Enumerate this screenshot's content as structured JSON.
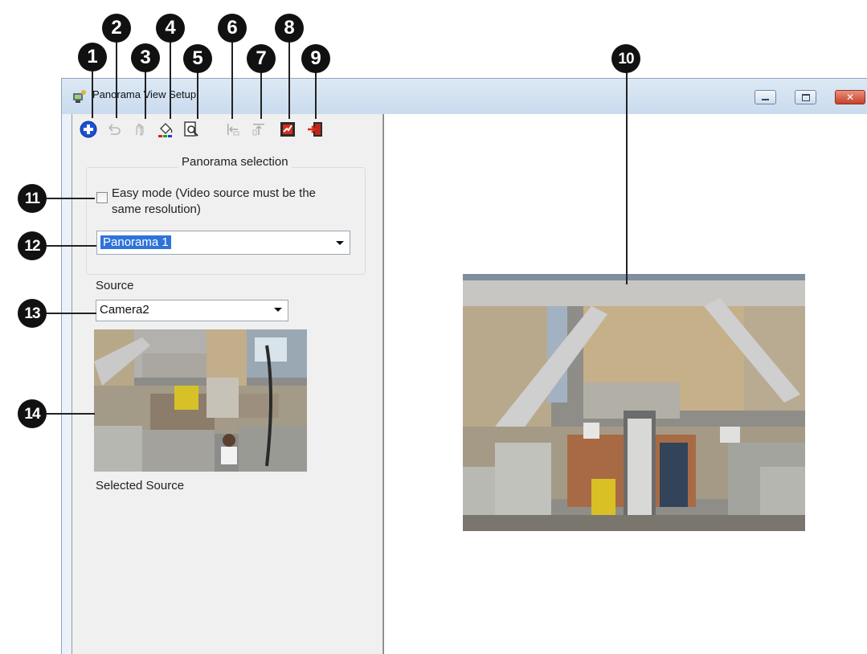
{
  "window": {
    "title": "Panorama View Setup"
  },
  "toolbar": {
    "buttons": [
      {
        "name": "add-icon",
        "color": "#1a4fd6"
      },
      {
        "name": "undo-icon"
      },
      {
        "name": "hand-icon"
      },
      {
        "name": "paint-bucket-icon"
      },
      {
        "name": "preview-icon"
      },
      {
        "name": "left-align-icon"
      },
      {
        "name": "up-align-icon"
      },
      {
        "name": "save-icon"
      },
      {
        "name": "exit-icon"
      }
    ]
  },
  "panorama_selection": {
    "title": "Panorama selection",
    "easy_mode_label": "Easy mode (Video source must be the same resolution)",
    "easy_mode_checked": false,
    "selected_panorama": "Panorama 1"
  },
  "source": {
    "label": "Source",
    "selected_camera": "Camera2",
    "caption": "Selected Source"
  },
  "callouts": [
    "1",
    "2",
    "3",
    "4",
    "5",
    "6",
    "7",
    "8",
    "9",
    "10",
    "11",
    "12",
    "13",
    "14"
  ],
  "colors": {
    "accent": "#2f73d9",
    "title_bar": "#c9dbee",
    "close_button": "#c6412a"
  }
}
